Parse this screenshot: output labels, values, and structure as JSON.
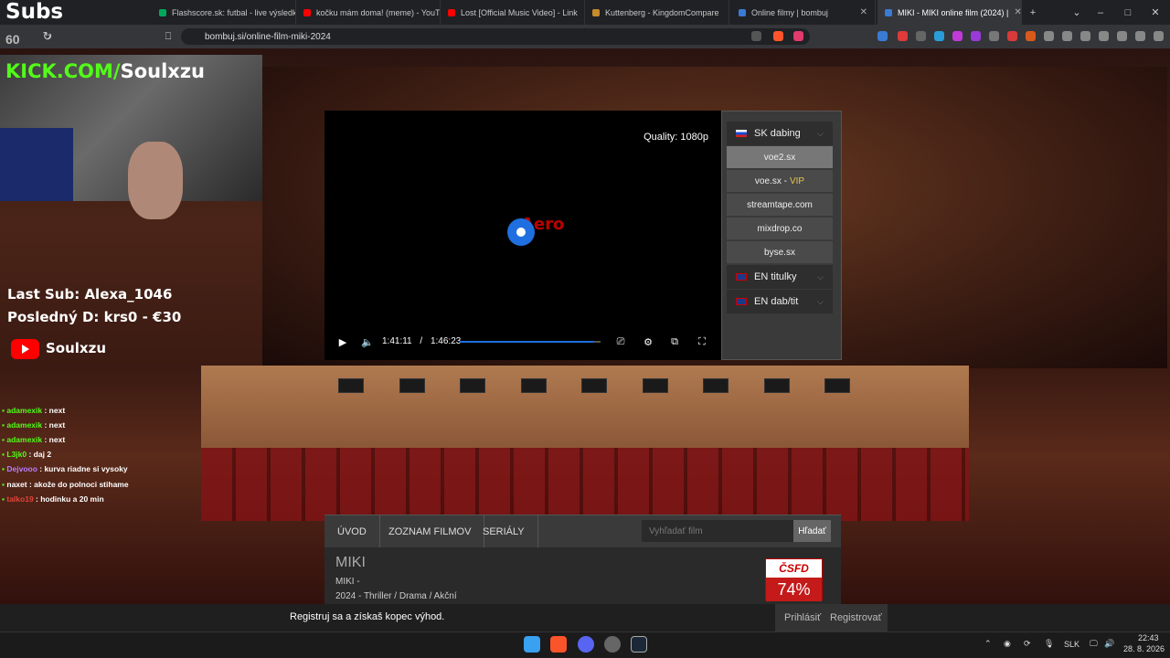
{
  "browser": {
    "tabs": [
      {
        "label": "Flashscore.sk: futbal - live výsledky a",
        "fav": "#00a859"
      },
      {
        "label": "kočku mám doma! (meme) - YouTu",
        "fav": "#ff0000"
      },
      {
        "label": "Lost [Official Music Video] - Link",
        "fav": "#ff0000"
      },
      {
        "label": "Kuttenberg - KingdomCompare",
        "fav": "#c88a2a"
      },
      {
        "label": "Online filmy | bombuj",
        "fav": "#3a7bd5"
      },
      {
        "label": "MIKI - MIKI online film (2024) |",
        "fav": "#3a7bd5"
      }
    ],
    "url": "bombuj.si/online-film-miki-2024"
  },
  "player": {
    "quality": "Quality: 1080p",
    "current_time": "1:41:11",
    "separator": "/",
    "duration": "1:46:23",
    "progress_fraction": 0.95
  },
  "servers": {
    "group_sk": "SK dabing",
    "items": [
      "voe2.sx",
      "voe.sx - ",
      "streamtape.com",
      "mixdrop.co",
      "byse.sx"
    ],
    "vip": "VIP",
    "group_en_sub": "EN titulky",
    "group_en_dub": "EN dab/tit"
  },
  "nav": {
    "home": "ÚVOD",
    "films": "ZOZNAM FILMOV",
    "series": "SERIÁLY",
    "search_placeholder": "Vyhľadať film",
    "search_button": "Hľadať"
  },
  "movie": {
    "title": "MIKI",
    "subtitle": "MIKI -",
    "meta": "2024 - Thriller / Drama / Akční",
    "rating": "74%",
    "rating_site": "ČSFD"
  },
  "register_bar": {
    "text": "Registruj sa a získaš kopec výhod.",
    "login": "Prihlásiť",
    "register": "Registrovať"
  },
  "overlay": {
    "subs": "Subs",
    "subs_count": "60",
    "kick_green": "KICK.COM/",
    "kick_white": "Soulxzu",
    "last_sub": "Last Sub: Alexa_1046",
    "last_donation": "Posledný D: krs0 - €30",
    "youtube": "Soulxzu",
    "chat": [
      {
        "user": "adamexik",
        "msg": " : next",
        "color": "#53fc18"
      },
      {
        "user": "adamexik",
        "msg": " : next",
        "color": "#53fc18"
      },
      {
        "user": "adamexik",
        "msg": " : next",
        "color": "#53fc18"
      },
      {
        "user": "L3jk0",
        "msg": " : daj 2",
        "color": "#53fc18"
      },
      {
        "user": "Dejvooo",
        "msg": " : kurva riadne si vysoky",
        "color": "#b77cff"
      },
      {
        "user": "naxet",
        "msg": " : akože do polnoci stihame",
        "color": "#ffffff"
      },
      {
        "user": "talko19",
        "msg": " : hodinku a 20 min",
        "color": "#e0443a"
      }
    ]
  },
  "taskbar": {
    "lang": "SLK",
    "time": "22:43",
    "date": "28. 8. 2026"
  }
}
